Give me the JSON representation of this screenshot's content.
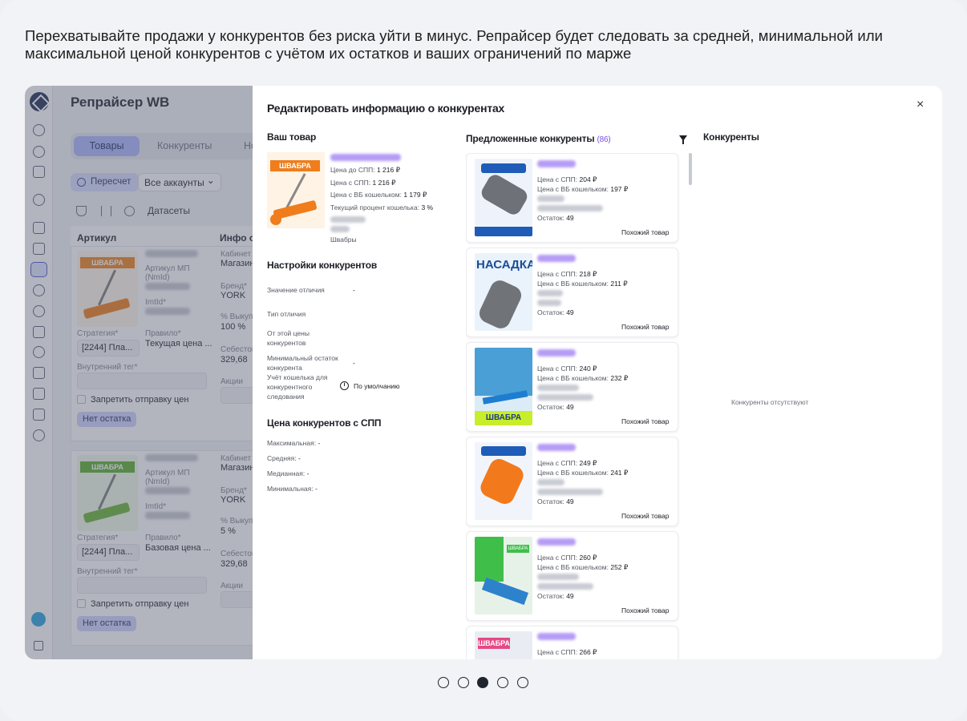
{
  "caption": "Перехватывайте продажи у конкурентов без риска уйти в минус. Репрайсер будет следовать за средней, минимальной или максимальной ценой конкурентов с учётом их остатков и ваших ограничений по марже",
  "app": {
    "title": "Репрайсер WB",
    "tabs": [
      "Товары",
      "Конкуренты",
      "Но"
    ],
    "recalc_label": "Пересчет",
    "accounts_label": "Все аккаунты",
    "datasets_label": "Датасеты",
    "columns": [
      "Артикул",
      "Инфо о"
    ],
    "rows": [
      {
        "mp_label": "Артикул МП",
        "nmid_label": "(NmId)",
        "imtid_label": "ImtId*",
        "strategy_label": "Стратегия*",
        "strategy_value": "[2244] Пла...",
        "rule_label": "Правило*",
        "rule_value": "Текущая цена ...",
        "tag_label": "Внутренний тег*",
        "block_label": "Запретить отправку цен",
        "stock_badge": "Нет остатка",
        "cabinet_label": "Кабинет",
        "cabinet_value": "Магазин",
        "brand_label": "Бренд*",
        "brand_value": "YORK",
        "buyout_label": "% Выкупа*",
        "buyout_value": "100 %",
        "cost_label": "Себестоим",
        "cost_value": "329,68",
        "promo_label": "Акции",
        "thumb_word": "ШВАБРА"
      },
      {
        "mp_label": "Артикул МП",
        "nmid_label": "(NmId)",
        "imtid_label": "ImtId*",
        "strategy_label": "Стратегия*",
        "strategy_value": "[2244] Пла...",
        "rule_label": "Правило*",
        "rule_value": "Базовая цена ...",
        "tag_label": "Внутренний тег*",
        "block_label": "Запретить отправку цен",
        "stock_badge": "Нет остатка",
        "cabinet_label": "Кабинет",
        "cabinet_value": "Магазин",
        "brand_label": "Бренд*",
        "brand_value": "YORK",
        "buyout_label": "% Выкупа*",
        "buyout_value": "5 %",
        "cost_label": "Себестоим",
        "cost_value": "329,68",
        "promo_label": "Акции",
        "thumb_word": "ШВАБРА"
      }
    ]
  },
  "modal": {
    "title": "Редактировать информацию о конкурентах",
    "close_label": "×",
    "your_product": {
      "heading": "Ваш товар",
      "thumb_word": "ШВАБРА",
      "price_before_spp_label": "Цена до СПП:",
      "price_before_spp": "1 216 ₽",
      "price_spp_label": "Цена с СПП:",
      "price_spp": "1 216 ₽",
      "price_wallet_label": "Цена с ВБ кошельком:",
      "price_wallet": "1 179 ₽",
      "wallet_percent_label": "Текущий процент кошелька:",
      "wallet_percent": "3 %",
      "category": "Швабры"
    },
    "settings": {
      "heading": "Настройки конкурентов",
      "diff_value_label": "Значение отличия",
      "diff_value": "-",
      "diff_type_label": "Тип отличия",
      "from_price_label": "От этой цены конкурентов",
      "min_stock_label": "Минимальный остаток конкурента",
      "min_stock_value": "-",
      "wallet_label": "Учёт кошелька для конкурентного следования",
      "wallet_value": "По умолчанию"
    },
    "spp_prices": {
      "heading": "Цена конкурентов с СПП",
      "max_label": "Максимальная:",
      "max_value": "-",
      "avg_label": "Средняя:",
      "avg_value": "-",
      "median_label": "Медианная:",
      "median_value": "-",
      "min_label": "Минимальная:",
      "min_value": "-"
    },
    "suggested": {
      "heading": "Предложенные конкуренты",
      "count": "(86)",
      "price_spp_label": "Цена с СПП:",
      "price_wallet_label": "Цена с ВБ кошельком:",
      "stock_label": "Остаток:",
      "similar_label": "Похожий товар",
      "items": [
        {
          "price_spp": "204 ₽",
          "price_wallet": "197 ₽",
          "stock": "49"
        },
        {
          "price_spp": "218 ₽",
          "price_wallet": "211 ₽",
          "stock": "49",
          "thumb_word": "НАСАДКА"
        },
        {
          "price_spp": "240 ₽",
          "price_wallet": "232 ₽",
          "stock": "49",
          "thumb_word": "ШВАБРА"
        },
        {
          "price_spp": "249 ₽",
          "price_wallet": "241 ₽",
          "stock": "49"
        },
        {
          "price_spp": "260 ₽",
          "price_wallet": "252 ₽",
          "stock": "49",
          "thumb_word": "ШВАБРА"
        },
        {
          "price_spp": "266 ₽",
          "thumb_word": "ШВАБРА"
        }
      ]
    },
    "competitors": {
      "heading": "Конкуренты",
      "empty": "Конкуренты отсутствуют"
    }
  },
  "pager": {
    "count": 5,
    "active": 2
  }
}
